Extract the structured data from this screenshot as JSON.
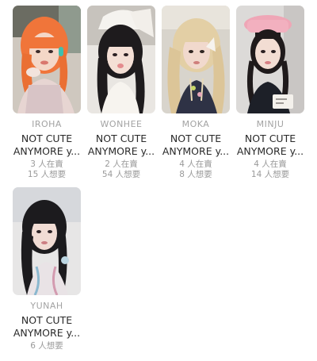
{
  "cards": [
    {
      "member": "IROHA",
      "title_line1": "NOT CUTE",
      "title_line2": "ANYMORE y...",
      "stats": [
        "3 人在賣",
        "15 人想要"
      ],
      "icon": "photocard-image"
    },
    {
      "member": "WONHEE",
      "title_line1": "NOT CUTE",
      "title_line2": "ANYMORE y...",
      "stats": [
        "2 人在賣",
        "54 人想要"
      ],
      "icon": "photocard-image"
    },
    {
      "member": "MOKA",
      "title_line1": "NOT CUTE",
      "title_line2": "ANYMORE y...",
      "stats": [
        "4 人在賣",
        "8 人想要"
      ],
      "icon": "photocard-image"
    },
    {
      "member": "MINJU",
      "title_line1": "NOT CUTE",
      "title_line2": "ANYMORE y...",
      "stats": [
        "4 人在賣",
        "14 人想要"
      ],
      "icon": "photocard-image"
    },
    {
      "member": "YUNAH",
      "title_line1": "NOT CUTE",
      "title_line2": "ANYMORE y...",
      "stats": [
        "6 人想要"
      ],
      "icon": "photocard-image"
    }
  ],
  "colors": {
    "background": "#ffffff",
    "name": "#a3a3a3",
    "title": "#2a2a2a",
    "stat": "#9a9a9a"
  }
}
